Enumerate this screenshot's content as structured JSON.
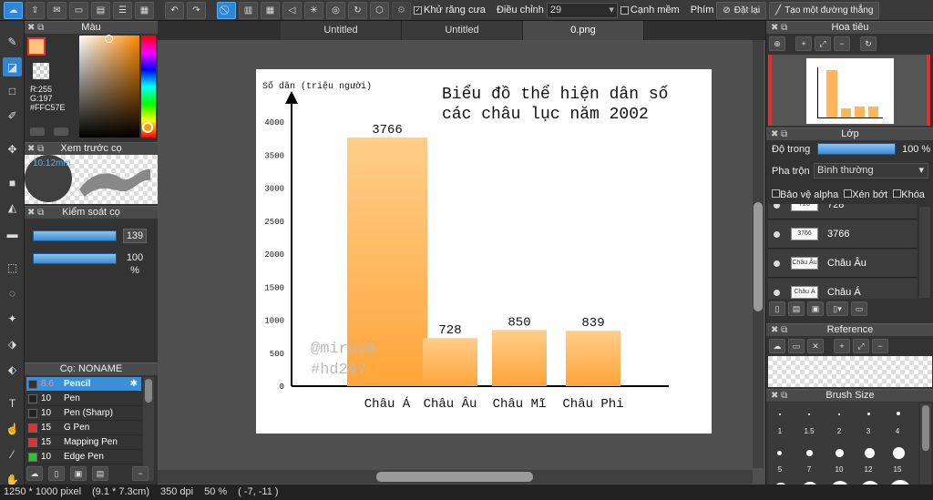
{
  "toolbar": {
    "antialias_label": "Khử răng cưa",
    "adjust_label": "Điều chỉnh",
    "adjust_value": "29",
    "snap_edge_label": "Cạnh mềm",
    "key_label": "Phím",
    "reset_label": "Đặt lại",
    "line_label": "Tạo một đường thẳng"
  },
  "left": {
    "color_title": "Màu",
    "rgb": {
      "r": "R:255",
      "g": "G:197",
      "hex": "#FFC57E"
    },
    "preview_title": "Xem trước cọ",
    "preview_size": "10.12mm",
    "control_title": "Kiểm soát cọ",
    "size_value": "139",
    "opacity_value": "100 %",
    "brush_title": "Cọ: NONAME",
    "brushes": [
      {
        "size": "8.6",
        "name": "Pencil",
        "color": "#333333"
      },
      {
        "size": "10",
        "name": "Pen",
        "color": "#222222"
      },
      {
        "size": "10",
        "name": "Pen (Sharp)",
        "color": "#222222"
      },
      {
        "size": "15",
        "name": "G Pen",
        "color": "#e03030"
      },
      {
        "size": "15",
        "name": "Mapping Pen",
        "color": "#e03030"
      },
      {
        "size": "10",
        "name": "Edge Pen",
        "color": "#30c030"
      }
    ]
  },
  "tabs": [
    "Untitled",
    "Untitled",
    "0.png"
  ],
  "artwork": {
    "ylabel": "Số dân (triệu người)",
    "title_line1": "Biểu đồ thể hiện dân số",
    "title_line2": "các châu lục năm 2002",
    "watermark1": "@miruyo",
    "watermark2": "#hd247"
  },
  "chart_data": {
    "type": "bar",
    "categories": [
      "Châu Á",
      "Châu Âu",
      "Châu Mĩ",
      "Châu Phi"
    ],
    "values": [
      3766,
      728,
      850,
      839
    ],
    "title": "Biểu đồ thể hiện dân số các châu lục năm 2002",
    "xlabel": "",
    "ylabel": "Số dân (triệu người)",
    "yticks": [
      "0",
      "500",
      "1000",
      "1500",
      "2000",
      "2500",
      "3000",
      "3500",
      "4000"
    ],
    "ylim": [
      0,
      4000
    ],
    "bar_color": "#FFA53A"
  },
  "right": {
    "navigator_title": "Hoa tiêu",
    "layer_title": "Lớp",
    "opacity_label": "Độ trong",
    "opacity_value": "100 %",
    "blend_label": "Pha trộn",
    "blend_value": "Bình thường",
    "protect_alpha": "Bảo vệ alpha",
    "clipping": "Xén bớt",
    "lock": "Khóa",
    "layers": [
      {
        "name": "728",
        "thumb": "728"
      },
      {
        "name": "3766",
        "thumb": "3766"
      },
      {
        "name": "Châu Âu",
        "thumb": "Châu Âu"
      },
      {
        "name": "Châu Á",
        "thumb": "Châu Á"
      }
    ],
    "reference_title": "Reference",
    "brushsize_title": "Brush Size",
    "brush_sizes_row1": [
      "1",
      "1.5",
      "2",
      "3",
      "4"
    ],
    "brush_sizes_row2": [
      "5",
      "7",
      "10",
      "12",
      "15"
    ]
  },
  "status": {
    "dims": "1250 * 1000 pixel",
    "cm": "(9.1 * 7.3cm)",
    "dpi": "350 dpi",
    "zoom": "50 %",
    "coords": "( -7, -11 )"
  }
}
